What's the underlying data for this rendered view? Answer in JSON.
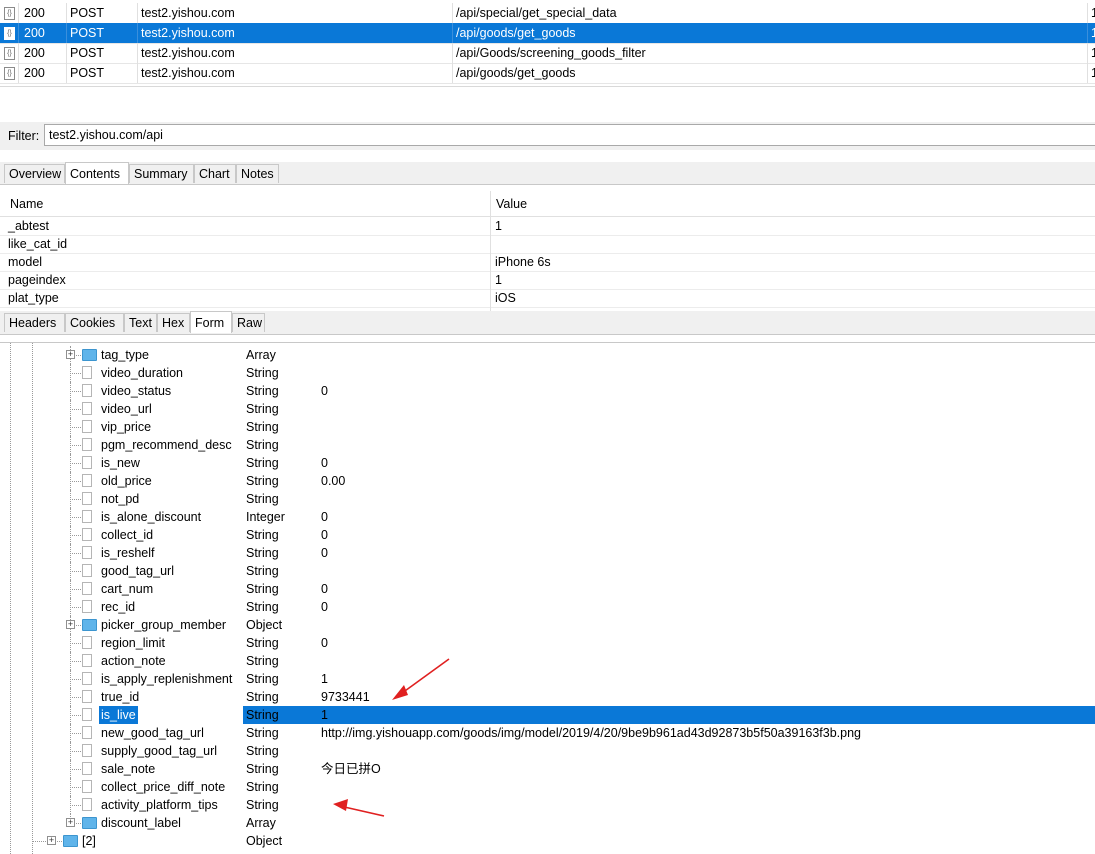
{
  "sessions": [
    {
      "code": "200",
      "method": "POST",
      "host": "test2.yishou.com",
      "url": "/api/special/get_special_data",
      "extra": "1",
      "selected": false
    },
    {
      "code": "200",
      "method": "POST",
      "host": "test2.yishou.com",
      "url": "/api/goods/get_goods",
      "extra": "1",
      "selected": true
    },
    {
      "code": "200",
      "method": "POST",
      "host": "test2.yishou.com",
      "url": "/api/Goods/screening_goods_filter",
      "extra": "1",
      "selected": false
    },
    {
      "code": "200",
      "method": "POST",
      "host": "test2.yishou.com",
      "url": "/api/goods/get_goods",
      "extra": "1",
      "selected": false
    }
  ],
  "filter": {
    "label": "Filter:",
    "value": "test2.yishou.com/api"
  },
  "top_tabs": [
    "Overview",
    "Contents",
    "Summary",
    "Chart",
    "Notes"
  ],
  "top_tab_active": "Contents",
  "grid": {
    "headers": {
      "name": "Name",
      "value": "Value"
    },
    "rows": [
      {
        "name": "_abtest",
        "value": "1"
      },
      {
        "name": "like_cat_id",
        "value": ""
      },
      {
        "name": "model",
        "value": "iPhone 6s"
      },
      {
        "name": "pageindex",
        "value": "1"
      },
      {
        "name": "plat_type",
        "value": "iOS"
      }
    ]
  },
  "sub_tabs": [
    "Headers",
    "Cookies",
    "Text",
    "Hex",
    "Form",
    "Raw"
  ],
  "sub_tab_active": "Form",
  "tree": [
    {
      "name": "tag_type",
      "type": "Array",
      "value": "",
      "kind": "folder"
    },
    {
      "name": "video_duration",
      "type": "String",
      "value": "",
      "kind": "doc"
    },
    {
      "name": "video_status",
      "type": "String",
      "value": "0",
      "kind": "doc"
    },
    {
      "name": "video_url",
      "type": "String",
      "value": "",
      "kind": "doc"
    },
    {
      "name": "vip_price",
      "type": "String",
      "value": "",
      "kind": "doc"
    },
    {
      "name": "pgm_recommend_desc",
      "type": "String",
      "value": "",
      "kind": "doc"
    },
    {
      "name": "is_new",
      "type": "String",
      "value": "0",
      "kind": "doc"
    },
    {
      "name": "old_price",
      "type": "String",
      "value": "0.00",
      "kind": "doc"
    },
    {
      "name": "not_pd",
      "type": "String",
      "value": "",
      "kind": "doc"
    },
    {
      "name": "is_alone_discount",
      "type": "Integer",
      "value": "0",
      "kind": "doc"
    },
    {
      "name": "collect_id",
      "type": "String",
      "value": "0",
      "kind": "doc"
    },
    {
      "name": "is_reshelf",
      "type": "String",
      "value": "0",
      "kind": "doc"
    },
    {
      "name": "good_tag_url",
      "type": "String",
      "value": "",
      "kind": "doc"
    },
    {
      "name": "cart_num",
      "type": "String",
      "value": "0",
      "kind": "doc"
    },
    {
      "name": "rec_id",
      "type": "String",
      "value": "0",
      "kind": "doc"
    },
    {
      "name": "picker_group_member",
      "type": "Object",
      "value": "",
      "kind": "folder"
    },
    {
      "name": "region_limit",
      "type": "String",
      "value": "0",
      "kind": "doc"
    },
    {
      "name": "action_note",
      "type": "String",
      "value": "",
      "kind": "doc"
    },
    {
      "name": "is_apply_replenishment",
      "type": "String",
      "value": "1",
      "kind": "doc"
    },
    {
      "name": "true_id",
      "type": "String",
      "value": "9733441",
      "kind": "doc"
    },
    {
      "name": "is_live",
      "type": "String",
      "value": "1",
      "kind": "doc",
      "selected": true
    },
    {
      "name": "new_good_tag_url",
      "type": "String",
      "value": "http://img.yishouapp.com/goods/img/model/2019/4/20/9be9b961ad43d92873b5f50a39163f3b.png",
      "kind": "doc"
    },
    {
      "name": "supply_good_tag_url",
      "type": "String",
      "value": "",
      "kind": "doc"
    },
    {
      "name": "sale_note",
      "type": "String",
      "value": "今日已拼O",
      "kind": "doc"
    },
    {
      "name": "collect_price_diff_note",
      "type": "String",
      "value": "",
      "kind": "doc"
    },
    {
      "name": "activity_platform_tips",
      "type": "String",
      "value": "",
      "kind": "doc"
    },
    {
      "name": "discount_label",
      "type": "Array",
      "value": "",
      "kind": "folder"
    },
    {
      "name": "[2]",
      "type": "Object",
      "value": "",
      "kind": "folder-root"
    }
  ],
  "colors": {
    "selection": "#0a78d7",
    "annotation_arrow": "#e02020"
  }
}
